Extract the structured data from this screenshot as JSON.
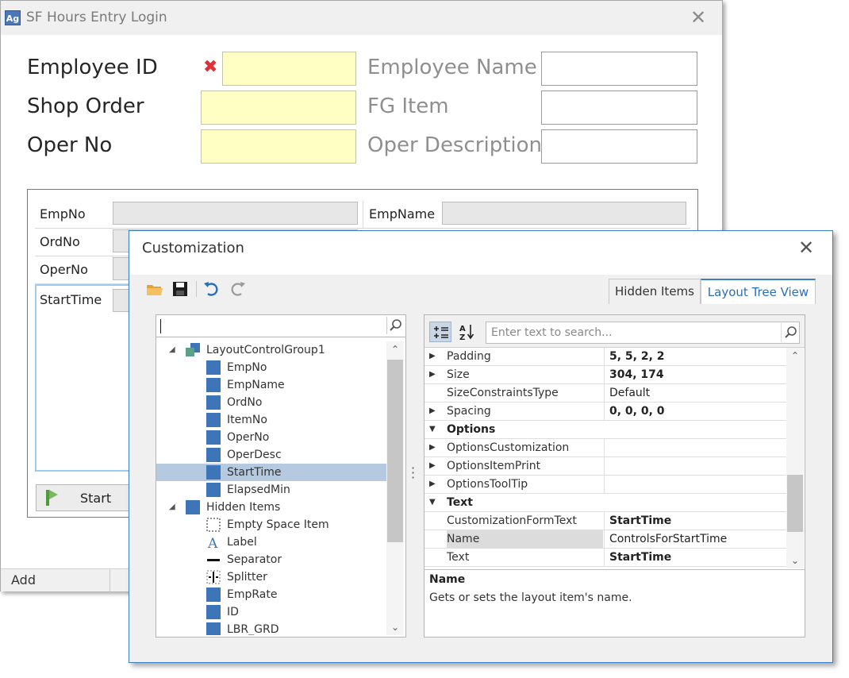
{
  "login_window": {
    "title": "SF Hours Entry Login",
    "app_icon_text": "Ag",
    "fields": {
      "employee_id_label": "Employee ID",
      "shop_order_label": "Shop Order",
      "oper_no_label": "Oper No",
      "employee_name_label": "Employee Name",
      "fg_item_label": "FG Item",
      "oper_description_label": "Oper Description"
    },
    "grid": {
      "empno_label": "EmpNo",
      "empname_label": "EmpName",
      "ordno_label": "OrdNo",
      "operno_label": "OperNo",
      "starttime_label": "StartTime"
    },
    "start_button": "Start",
    "status_add": "Add"
  },
  "customization": {
    "title": "Customization",
    "tabs": [
      "Hidden Items",
      "Layout Tree View"
    ],
    "active_tab": "Layout Tree View",
    "tree": {
      "items": [
        {
          "label": "LayoutControlGroup1",
          "level": 0,
          "expanded": true,
          "icon": "group-icon"
        },
        {
          "label": "EmpNo",
          "level": 1,
          "icon": "item-icon"
        },
        {
          "label": "EmpName",
          "level": 1,
          "icon": "item-icon"
        },
        {
          "label": "OrdNo",
          "level": 1,
          "icon": "item-icon"
        },
        {
          "label": "ItemNo",
          "level": 1,
          "icon": "item-icon"
        },
        {
          "label": "OperNo",
          "level": 1,
          "icon": "item-icon"
        },
        {
          "label": "OperDesc",
          "level": 1,
          "icon": "item-icon"
        },
        {
          "label": "StartTime",
          "level": 1,
          "icon": "item-icon",
          "selected": true
        },
        {
          "label": "ElapsedMin",
          "level": 1,
          "icon": "item-icon"
        },
        {
          "label": "Hidden Items",
          "level": 0,
          "expanded": true,
          "icon": "item-icon"
        },
        {
          "label": "Empty Space Item",
          "level": 1,
          "icon": "empty-space-icon"
        },
        {
          "label": "Label",
          "level": 1,
          "icon": "label-icon"
        },
        {
          "label": "Separator",
          "level": 1,
          "icon": "separator-icon"
        },
        {
          "label": "Splitter",
          "level": 1,
          "icon": "splitter-icon"
        },
        {
          "label": "EmpRate",
          "level": 1,
          "icon": "item-icon"
        },
        {
          "label": "ID",
          "level": 1,
          "icon": "item-icon"
        },
        {
          "label": "LBR_GRD",
          "level": 1,
          "icon": "item-icon"
        }
      ]
    },
    "properties": {
      "search_placeholder": "Enter text to search...",
      "rows": [
        {
          "name": "Padding",
          "value": "5, 5, 2, 2",
          "expander": "right",
          "bold": true
        },
        {
          "name": "Size",
          "value": "304, 174",
          "expander": "right",
          "bold": true
        },
        {
          "name": "SizeConstraintsType",
          "value": "Default",
          "expander": "none",
          "bold": false
        },
        {
          "name": "Spacing",
          "value": "0, 0, 0, 0",
          "expander": "right",
          "bold": true
        },
        {
          "name": "Options",
          "value": "",
          "expander": "down",
          "category": true
        },
        {
          "name": "OptionsCustomization",
          "value": "",
          "expander": "right",
          "bold": false
        },
        {
          "name": "OptionsItemPrint",
          "value": "",
          "expander": "right",
          "bold": false
        },
        {
          "name": "OptionsToolTip",
          "value": "",
          "expander": "right",
          "bold": false
        },
        {
          "name": "Text",
          "value": "",
          "expander": "down",
          "category": true
        },
        {
          "name": "CustomizationFormText",
          "value": "StartTime",
          "expander": "none",
          "bold": true
        },
        {
          "name": "Name",
          "value": "ControlsForStartTime",
          "expander": "none",
          "bold": false,
          "highlight": true
        },
        {
          "name": "Text",
          "value": "StartTime",
          "expander": "none",
          "bold": true
        }
      ],
      "description_title": "Name",
      "description_text": "Gets or sets the layout item's name."
    }
  },
  "colors": {
    "accent": "#3c7fc4",
    "required_field": "#ffffc4",
    "selection": "#b5c9e0",
    "tree_item_icon": "#3d75b8",
    "error": "#e2303b"
  }
}
